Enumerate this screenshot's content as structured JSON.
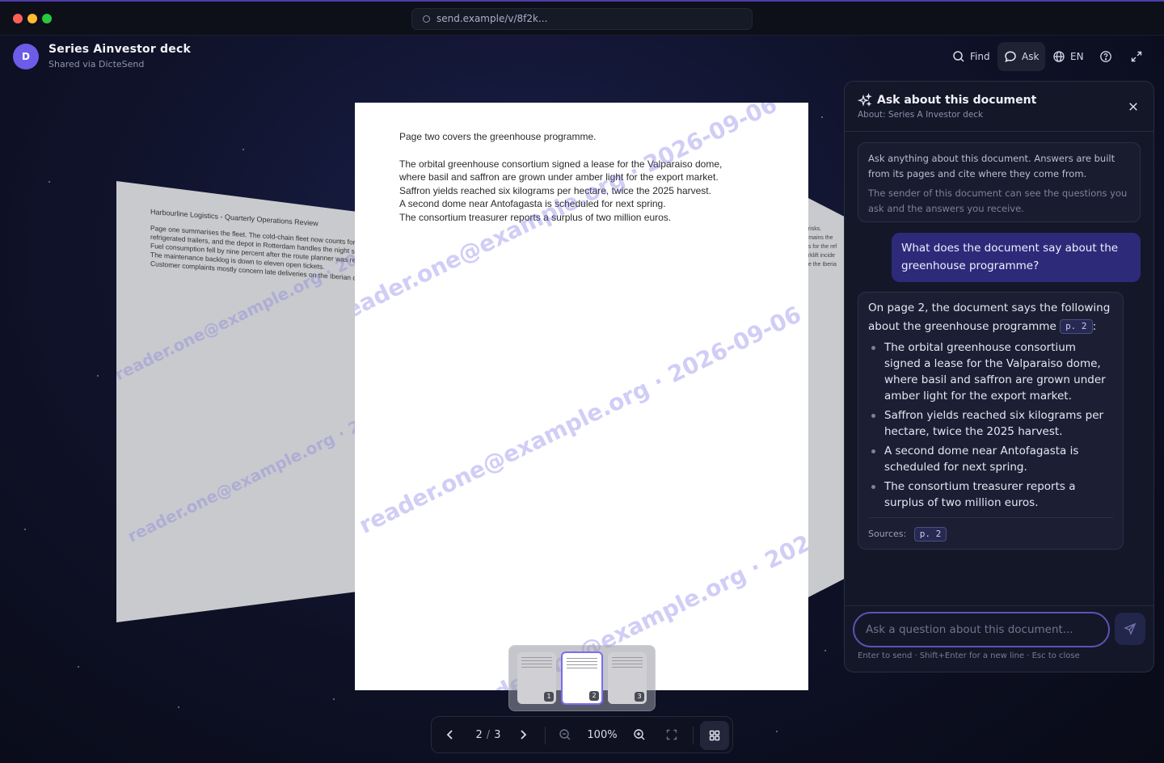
{
  "window": {
    "url": "send.example/v/8f2k...",
    "colors": {
      "close": "#ff5f57",
      "minimize": "#febc2e",
      "zoom": "#28c840"
    }
  },
  "header": {
    "avatar_letter": "D",
    "title": "Series Ainvestor deck",
    "subtitle": "Shared via DicteSend",
    "find_label": "Find",
    "ask_label": "Ask",
    "lang_label": "EN",
    "icons": [
      "search-icon",
      "chat-icon",
      "globe-icon",
      "help-icon",
      "expand-icon"
    ]
  },
  "pages": {
    "left": {
      "title": "Harbourline Logistics - Quarterly Operations Review",
      "lines": [
        "Page one summarises the fleet. The cold-chain fleet now counts forty",
        "refrigerated trailers, and the depot in Rotterdam handles the night shi",
        "Fuel consumption fell by nine percent after the route planner was ret",
        "The maintenance backlog is down to eleven open tickets.",
        "Customer complaints mostly concern late deliveries on the Iberian co"
      ]
    },
    "main": {
      "intro": "Page two covers the greenhouse programme.",
      "lines": [
        "The orbital greenhouse consortium signed a lease for the Valparaiso dome,",
        "where basil and saffron are grown under amber light for the export market.",
        "Saffron yields reached six kilograms per hectare, twice the 2025 harvest.",
        "A second dome near Antofagasta is scheduled for next spring.",
        "The consortium treasurer reports a surplus of two million euros."
      ]
    },
    "right": {
      "lines": [
        "e risks.",
        "",
        "remains the",
        "ms for the ref",
        "forklift incide",
        "ute the Iberia"
      ]
    },
    "watermark": "reader.one@example.org · 2026-09-06"
  },
  "thumbnails": [
    {
      "num": "1",
      "active": false
    },
    {
      "num": "2",
      "active": true
    },
    {
      "num": "3",
      "active": false
    }
  ],
  "toolbar": {
    "page_current": "2",
    "page_sep": "/",
    "page_total": "3",
    "zoom": "100%"
  },
  "ask_panel": {
    "title": "Ask about this document",
    "about": "About: Series A Investor deck",
    "info_main": "Ask anything about this document. Answers are built from its pages and cite where they come from.",
    "info_privacy": "The sender of this document can see the questions you ask and the answers you receive.",
    "user_question": "What does the document say about the greenhouse programme?",
    "answer_intro": "On page 2, the document says the following about the greenhouse programme",
    "answer_cite": "p. 2",
    "answer_bullets": [
      "The orbital greenhouse consortium signed a lease for the Valparaiso dome, where basil and saffron are grown under amber light for the export market.",
      "Saffron yields reached six kilograms per hectare, twice the 2025 harvest.",
      "A second dome near Antofagasta is scheduled for next spring.",
      "The consortium treasurer reports a surplus of two million euros."
    ],
    "sources_label": "Sources:",
    "sources_cite": "p. 2",
    "input_placeholder": "Ask a question about this document...",
    "hint": "Enter to send · Shift+Enter for a new line · Esc to close"
  }
}
